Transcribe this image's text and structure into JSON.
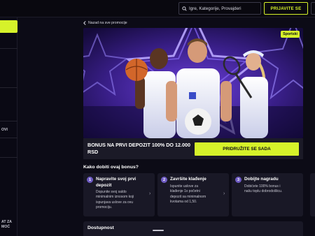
{
  "header": {
    "search_placeholder": "Igre, Kategorije, Provajderi",
    "register_label": "PRIJAVITE SE"
  },
  "sidebar": {
    "partial_1": "OVI",
    "partial_2": "AT ZA",
    "partial_3": "MOĆ"
  },
  "back_link": "Nazad na sve promocije",
  "banner": {
    "badge": "Sportski"
  },
  "promo": {
    "title": "BONUS NA PRVI DEPOZIT 100% DO 12.000 RSD",
    "join_label": "PRIDRUŽITE SE SADA"
  },
  "howto": {
    "title": "Kako dobiti ovaj bonus?",
    "steps": [
      {
        "num": "1",
        "title_1": "Napravite svoj prvi",
        "title_2": "depozit",
        "desc": [
          "Dopunite svoj saldo",
          "minimalnim iznosom koji",
          "ispunjava uslove za ovu",
          "promociju."
        ]
      },
      {
        "num": "2",
        "title_1": "Završite klađenje",
        "desc": [
          "Ispunite uslove za",
          "klađenje 1x početni",
          "depozit sa minimalnom",
          "kvotama od 1,50."
        ]
      },
      {
        "num": "3",
        "title_1": "Dobijte nagradu",
        "desc": [
          "Dobićete 100% bonus i",
          "našu toplu dobrodošlicu."
        ]
      }
    ]
  },
  "availability": {
    "title": "Dostupnost"
  },
  "colors": {
    "accent": "#d6f22a",
    "background": "#0c0b16",
    "card": "#191826",
    "step_badge": "#6f5cc4"
  }
}
